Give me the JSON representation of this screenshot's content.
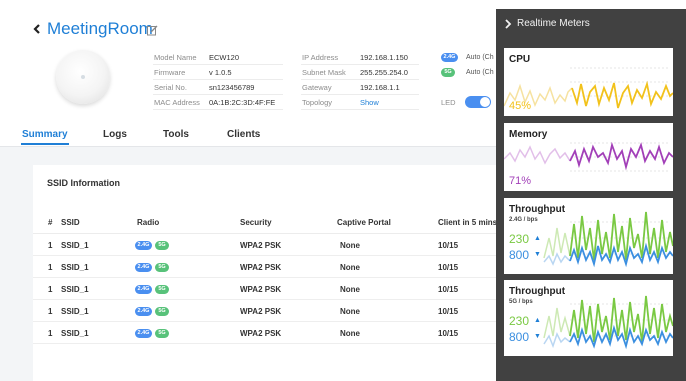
{
  "device": {
    "name": "MeetingRoom"
  },
  "info": {
    "col1": [
      {
        "label": "Model Name",
        "value": "ECW120"
      },
      {
        "label": "Firmware",
        "value": "v 1.0.5"
      },
      {
        "label": "Serial No.",
        "value": "sn123456789"
      },
      {
        "label": "MAC Address",
        "value": "0A:1B:2C:3D:4F:FE"
      }
    ],
    "col2": [
      {
        "label": "IP Address",
        "value": "192.168.1.150"
      },
      {
        "label": "Subnet Mask",
        "value": "255.255.254.0"
      },
      {
        "label": "Gateway",
        "value": "192.168.1.1"
      },
      {
        "label": "Topology",
        "value": "Show"
      }
    ],
    "radio": [
      {
        "band": "2.4G",
        "mode": "Auto (Ch"
      },
      {
        "band": "5G",
        "mode": "Auto (Ch"
      }
    ],
    "led_label": "LED",
    "led_on": true
  },
  "tabs": [
    "Summary",
    "Logs",
    "Tools",
    "Clients"
  ],
  "ssid": {
    "title": "SSID Information",
    "headers": [
      "#",
      "SSID",
      "Radio",
      "Security",
      "Captive Portal",
      "Client in 5 mins"
    ],
    "rows": [
      {
        "num": "1",
        "ssid": "SSID_1",
        "radio": [
          "2.4G",
          "5G"
        ],
        "security": "WPA2 PSK",
        "portal": "None",
        "clients": "10/15"
      },
      {
        "num": "1",
        "ssid": "SSID_1",
        "radio": [
          "2.4G",
          "5G"
        ],
        "security": "WPA2 PSK",
        "portal": "None",
        "clients": "10/15"
      },
      {
        "num": "1",
        "ssid": "SSID_1",
        "radio": [
          "2.4G",
          "5G"
        ],
        "security": "WPA2 PSK",
        "portal": "None",
        "clients": "10/15"
      },
      {
        "num": "1",
        "ssid": "SSID_1",
        "radio": [
          "2.4G",
          "5G"
        ],
        "security": "WPA2 PSK",
        "portal": "None",
        "clients": "10/15"
      },
      {
        "num": "1",
        "ssid": "SSID_1",
        "radio": [
          "2.4G",
          "5G"
        ],
        "security": "WPA2 PSK",
        "portal": "None",
        "clients": "10/15"
      }
    ]
  },
  "meters": {
    "title": "Realtime Meters",
    "cpu": {
      "title": "CPU",
      "value": "45%",
      "color": "#f2c21b"
    },
    "memory": {
      "title": "Memory",
      "value": "71%",
      "color": "#a23fb8"
    },
    "throughput24": {
      "title": "Throughput",
      "sub": "2.4G / bps",
      "up": "230",
      "down": "800"
    },
    "throughput5": {
      "title": "Throughput",
      "sub": "5G / bps",
      "up": "230",
      "down": "800"
    },
    "up_color": "#7ac943",
    "down_color": "#3b8fe0"
  },
  "colors": {
    "accent": "#1f7fd6",
    "band_24": "#4a8ff0",
    "band_5": "#58c27a",
    "panel_bg": "#414141"
  },
  "icons": {
    "back": "chevron-left-icon",
    "edit": "edit-icon",
    "panel_toggle": "chevron-right-icon",
    "up": "arrow-up-icon",
    "down": "arrow-down-icon"
  }
}
